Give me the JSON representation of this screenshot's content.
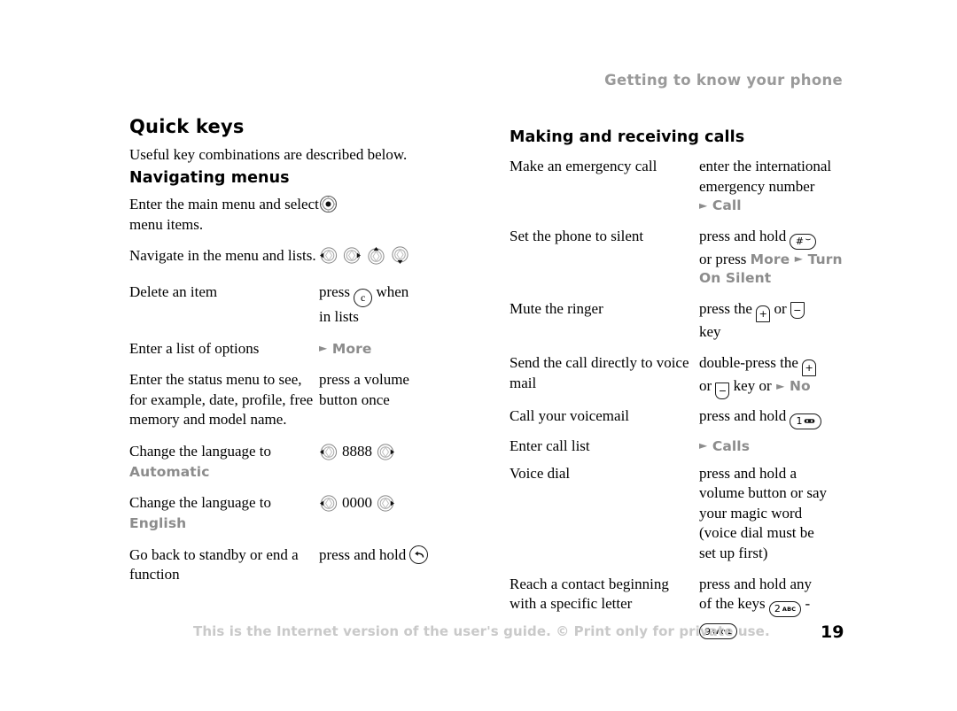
{
  "header": {
    "running_title": "Getting to know your phone"
  },
  "left_column": {
    "title": "Quick keys",
    "lead": "Useful key combinations are described below.",
    "subsection_title": "Navigating menus",
    "rows": [
      {
        "term": "Enter the main menu and select menu items.",
        "desc_kind": "nav-center"
      },
      {
        "term": "Navigate in the menu and lists.",
        "desc_kind": "nav-four"
      },
      {
        "term": "Delete an item",
        "desc_kind": "clear-key",
        "desc_before": "press",
        "desc_after": "when",
        "desc_line2": "in lists",
        "key_label": "c"
      },
      {
        "term": "Enter a list of options",
        "desc_kind": "uilabel",
        "ui_text": "More"
      },
      {
        "term": "Enter the status menu to see, for example, date, profile, free memory and model name.",
        "desc_kind": "text",
        "desc_line1": "press a volume",
        "desc_line2": "button once"
      },
      {
        "term": "Change the language to ",
        "term_ui": "Automatic",
        "desc_kind": "nav-digits",
        "digits": "8888"
      },
      {
        "term": "Change the language to ",
        "term_ui": "English",
        "desc_kind": "nav-digits",
        "digits": "0000"
      },
      {
        "term": "Go back to standby or end a function",
        "desc_kind": "back-key",
        "desc_before": "press and hold"
      }
    ]
  },
  "right_column": {
    "title": "Making and receiving calls",
    "rows": [
      {
        "term": "Make an emergency call",
        "desc_line1": "enter the international",
        "desc_line2": "emergency number",
        "ui_text": "Call"
      },
      {
        "term": "Set the phone to silent",
        "desc_before": "press and hold",
        "key": "hash",
        "desc_line2_before": "or press ",
        "ui_text_a": "More",
        "ui_text_b": "Turn",
        "desc_line3_ui": "On Silent"
      },
      {
        "term": "Mute the ringer",
        "desc_before": "press the",
        "desc_mid": "or",
        "desc_line2": "key"
      },
      {
        "term": "Send the call directly to voice mail",
        "desc_before": "double-press the",
        "desc_line2_before": "or",
        "desc_line2_mid": "key or",
        "ui_text": "No"
      },
      {
        "term": "Call your voicemail",
        "desc_before": "press and hold",
        "key": "voicemail-1"
      },
      {
        "term": "Enter call list",
        "ui_text": "Calls"
      },
      {
        "term": "Voice dial",
        "desc_lines": [
          "press and hold a",
          "volume button or say",
          "your magic word",
          "(voice dial must be",
          "set up first)"
        ]
      },
      {
        "term": "Reach a contact beginning with a specific letter",
        "desc_line1": "press and hold any",
        "desc_line2_before": "of the keys",
        "key_a": "2 ABC",
        "dash": "-",
        "key_b": "9 WXYZ"
      }
    ]
  },
  "footer": {
    "note": "This is the Internet version of the user's guide. © Print only for private use.",
    "page_number": "19"
  },
  "keys": {
    "clear": "c",
    "hash_digit": "#",
    "one_digit": "1",
    "two_digit": "2",
    "two_letters": "ABC",
    "nine_digit": "9",
    "nine_letters": "WXYZ",
    "volume_up": "+",
    "volume_down": "−"
  },
  "colors": {
    "ui_label_gray": "#8c8c8c",
    "header_gray": "#9a9a9a",
    "footer_gray": "#c9c9c9",
    "text_black": "#000000"
  }
}
